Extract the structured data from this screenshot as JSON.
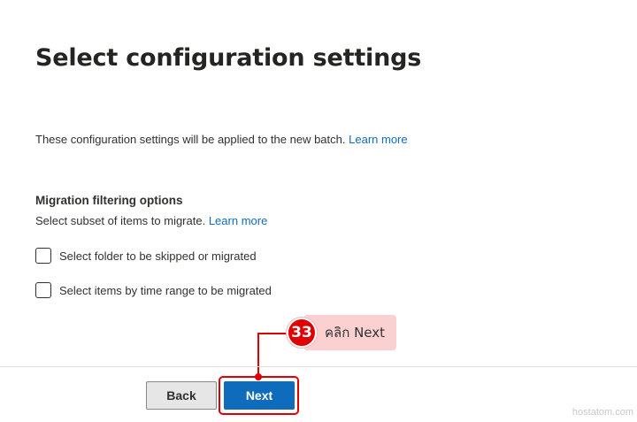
{
  "page": {
    "title": "Select configuration settings",
    "description": "These configuration settings will be applied to the new batch.",
    "description_link": "Learn more"
  },
  "filtering": {
    "heading": "Migration filtering options",
    "subtitle": "Select subset of items to migrate.",
    "subtitle_link": "Learn more",
    "options": [
      {
        "label": "Select folder to be skipped or migrated",
        "checked": false
      },
      {
        "label": "Select items by time range to be migrated",
        "checked": false
      }
    ]
  },
  "footer": {
    "back_label": "Back",
    "next_label": "Next"
  },
  "annotation": {
    "step_number": "33",
    "text": "คลิก Next",
    "color": "#e00000"
  },
  "watermark": "hostatom.com"
}
